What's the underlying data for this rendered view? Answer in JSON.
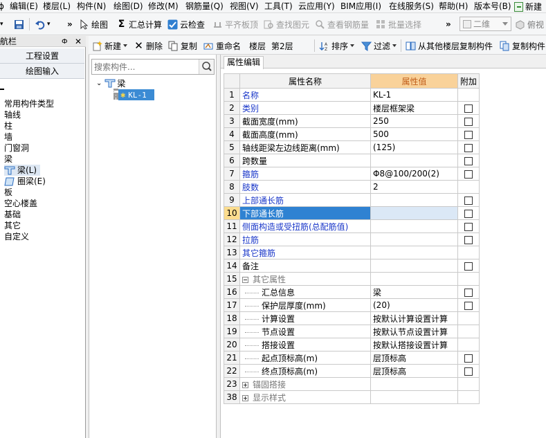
{
  "menubar": {
    "items": [
      "编辑(E)",
      "楼层(L)",
      "构件(N)",
      "绘图(D)",
      "修改(M)",
      "钢筋量(Q)",
      "视图(V)",
      "工具(T)",
      "云应用(Y)",
      "BIM应用(I)",
      "在线服务(S)",
      "帮助(H)",
      "版本号(B)",
      "新建"
    ]
  },
  "toolbar1": {
    "draw": "绘图",
    "sum": "汇总计算",
    "cloud_check": "云检查",
    "level_slab": "平齐板顶",
    "find_element": "查找图元",
    "view_rebar": "查看钢筋量",
    "batch_select": "批量选择",
    "view_mode": "二维",
    "view_angle": "俯视"
  },
  "toolbar2": {
    "new": "新建",
    "delete": "删除",
    "copy": "复制",
    "rename": "重命名",
    "floor_label": "楼层",
    "floor_value": "第2层",
    "sort": "排序",
    "filter": "过滤",
    "copy_from_other": "从其他楼层复制构件",
    "copy_component": "复制构件"
  },
  "nav": {
    "title": "航栏",
    "pin": "Ф",
    "close": "✕",
    "btn_project": "工程设置",
    "btn_draw": "绘图输入",
    "items": [
      "常用构件类型",
      "轴线",
      "柱",
      "墙",
      "门窗洞",
      "梁"
    ],
    "beam_sub": [
      "梁(L)",
      "圈梁(E)"
    ],
    "items_after": [
      "板",
      "空心楼盖",
      "基础",
      "其它",
      "自定义"
    ]
  },
  "tree": {
    "search_placeholder": "搜索构件...",
    "root": "梁",
    "child": "KL-1"
  },
  "props": {
    "tab": "属性编辑",
    "header_name": "属性名称",
    "header_value": "属性值",
    "header_extra": "附加",
    "rows": [
      {
        "num": "1",
        "name": "名称",
        "value": "KL-1"
      },
      {
        "num": "2",
        "name": "类别",
        "value": "楼层框架梁"
      },
      {
        "num": "3",
        "name": "截面宽度(mm)",
        "value": "250"
      },
      {
        "num": "4",
        "name": "截面高度(mm)",
        "value": "500"
      },
      {
        "num": "5",
        "name": "轴线距梁左边线距离(mm)",
        "value": "(125)"
      },
      {
        "num": "6",
        "name": "跨数量",
        "value": ""
      },
      {
        "num": "7",
        "name": "箍筋",
        "value": "Φ8@100/200(2)"
      },
      {
        "num": "8",
        "name": "肢数",
        "value": "2"
      },
      {
        "num": "9",
        "name": "上部通长筋",
        "value": ""
      },
      {
        "num": "10",
        "name": "下部通长筋",
        "value": ""
      },
      {
        "num": "11",
        "name": "侧面构造或受扭筋(总配筋值)",
        "value": ""
      },
      {
        "num": "12",
        "name": "拉筋",
        "value": ""
      },
      {
        "num": "13",
        "name": "其它箍筋",
        "value": ""
      },
      {
        "num": "14",
        "name": "备注",
        "value": ""
      },
      {
        "num": "15",
        "name": "其它属性",
        "value": ""
      },
      {
        "num": "16",
        "name": "汇总信息",
        "value": "梁"
      },
      {
        "num": "17",
        "name": "保护层厚度(mm)",
        "value": "(20)"
      },
      {
        "num": "18",
        "name": "计算设置",
        "value": "按默认计算设置计算"
      },
      {
        "num": "19",
        "name": "节点设置",
        "value": "按默认节点设置计算"
      },
      {
        "num": "20",
        "name": "搭接设置",
        "value": "按默认搭接设置计算"
      },
      {
        "num": "21",
        "name": "起点顶标高(m)",
        "value": "层顶标高"
      },
      {
        "num": "22",
        "name": "终点顶标高(m)",
        "value": "层顶标高"
      },
      {
        "num": "23",
        "name": "锚固搭接",
        "value": ""
      },
      {
        "num": "38",
        "name": "显示样式",
        "value": ""
      }
    ]
  }
}
